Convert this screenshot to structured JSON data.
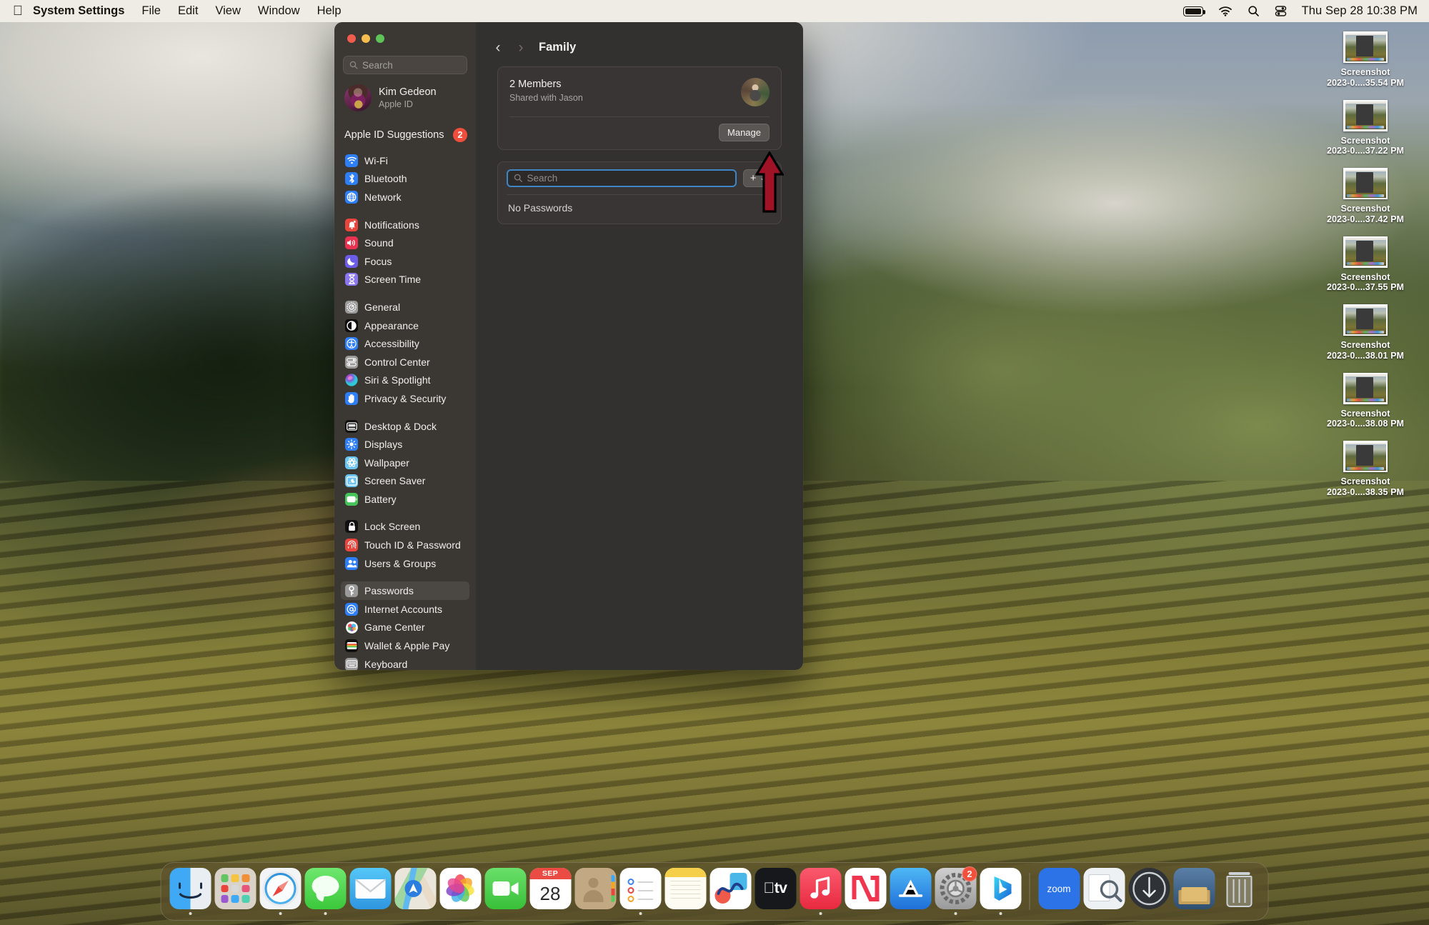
{
  "menubar": {
    "apple_icon": "apple-logo",
    "items": [
      "System Settings",
      "File",
      "Edit",
      "View",
      "Window",
      "Help"
    ],
    "status_icons": [
      "battery-icon",
      "wifi-icon",
      "search-icon",
      "control-center-icon"
    ],
    "clock": "Thu Sep 28  10:38 PM"
  },
  "desktop_icons": [
    {
      "line1": "Screenshot",
      "line2": "2023-0....35.54 PM"
    },
    {
      "line1": "Screenshot",
      "line2": "2023-0....37.22 PM"
    },
    {
      "line1": "Screenshot",
      "line2": "2023-0....37.42 PM"
    },
    {
      "line1": "Screenshot",
      "line2": "2023-0....37.55 PM"
    },
    {
      "line1": "Screenshot",
      "line2": "2023-0....38.01 PM"
    },
    {
      "line1": "Screenshot",
      "line2": "2023-0....38.08 PM"
    },
    {
      "line1": "Screenshot",
      "line2": "2023-0....38.35 PM"
    }
  ],
  "sidebar": {
    "search_placeholder": "Search",
    "account": {
      "name": "Kim Gedeon",
      "subtitle": "Apple ID"
    },
    "suggestions": {
      "label": "Apple ID Suggestions",
      "badge": "2"
    },
    "items": [
      {
        "label": "Wi-Fi",
        "icon": "wifi-icon",
        "color": "#2d7ef7",
        "selected": false,
        "gap_after": false
      },
      {
        "label": "Bluetooth",
        "icon": "bluetooth-icon",
        "color": "#2d7ef7",
        "selected": false,
        "gap_after": false
      },
      {
        "label": "Network",
        "icon": "globe-icon",
        "color": "#2d7ef7",
        "selected": false,
        "gap_after": true
      },
      {
        "label": "Notifications",
        "icon": "bell-icon",
        "color": "#e8453c",
        "selected": false,
        "gap_after": false
      },
      {
        "label": "Sound",
        "icon": "speaker-icon",
        "color": "#e8324f",
        "selected": false,
        "gap_after": false
      },
      {
        "label": "Focus",
        "icon": "moon-icon",
        "color": "#6c5ce7",
        "selected": false,
        "gap_after": false
      },
      {
        "label": "Screen Time",
        "icon": "hourglass-icon",
        "color": "#8a76f0",
        "selected": false,
        "gap_after": true
      },
      {
        "label": "General",
        "icon": "gear-icon",
        "color": "#9a9a9a",
        "selected": false,
        "gap_after": false
      },
      {
        "label": "Appearance",
        "icon": "contrast-icon",
        "color": "#0d0d0d",
        "selected": false,
        "gap_after": false
      },
      {
        "label": "Accessibility",
        "icon": "accessibility-icon",
        "color": "#2d7ef7",
        "selected": false,
        "gap_after": false
      },
      {
        "label": "Control Center",
        "icon": "control-center-icon",
        "color": "#9a9a9a",
        "selected": false,
        "gap_after": false
      },
      {
        "label": "Siri & Spotlight",
        "icon": "siri-icon",
        "color": "#6a4ac0",
        "selected": false,
        "gap_after": false
      },
      {
        "label": "Privacy & Security",
        "icon": "hand-icon",
        "color": "#2d7ef7",
        "selected": false,
        "gap_after": true
      },
      {
        "label": "Desktop & Dock",
        "icon": "desktop-dock-icon",
        "color": "#111111",
        "selected": false,
        "gap_after": false
      },
      {
        "label": "Displays",
        "icon": "brightness-icon",
        "color": "#2d7ef7",
        "selected": false,
        "gap_after": false
      },
      {
        "label": "Wallpaper",
        "icon": "wallpaper-icon",
        "color": "#6cc4f0",
        "selected": false,
        "gap_after": false
      },
      {
        "label": "Screen Saver",
        "icon": "screensaver-icon",
        "color": "#6cc4f0",
        "selected": false,
        "gap_after": false
      },
      {
        "label": "Battery",
        "icon": "battery-icon",
        "color": "#45c45a",
        "selected": false,
        "gap_after": true
      },
      {
        "label": "Lock Screen",
        "icon": "lock-icon",
        "color": "#111111",
        "selected": false,
        "gap_after": false
      },
      {
        "label": "Touch ID & Password",
        "icon": "touchid-icon",
        "color": "#e8453c",
        "selected": false,
        "gap_after": false
      },
      {
        "label": "Users & Groups",
        "icon": "users-icon",
        "color": "#2d7ef7",
        "selected": false,
        "gap_after": true
      },
      {
        "label": "Passwords",
        "icon": "key-icon",
        "color": "#9a9a9a",
        "selected": true,
        "gap_after": false
      },
      {
        "label": "Internet Accounts",
        "icon": "at-sign-icon",
        "color": "#2d7ef7",
        "selected": false,
        "gap_after": false
      },
      {
        "label": "Game Center",
        "icon": "game-center-icon",
        "color": "#ffffff",
        "selected": false,
        "gap_after": false
      },
      {
        "label": "Wallet & Apple Pay",
        "icon": "wallet-icon",
        "color": "#111111",
        "selected": false,
        "gap_after": false
      },
      {
        "label": "Keyboard",
        "icon": "keyboard-icon",
        "color": "#9a9a9a",
        "selected": false,
        "gap_after": false
      }
    ]
  },
  "main": {
    "back_icon": "chevron-left-icon",
    "forward_icon": "chevron-right-icon",
    "title": "Family",
    "family_card": {
      "members": "2 Members",
      "shared_with": "Shared with Jason",
      "manage_label": "Manage"
    },
    "passwords_card": {
      "search_placeholder": "Search",
      "add_label": "+",
      "add_chevron": "⌄",
      "empty_text": "No Passwords"
    }
  },
  "annotation": {
    "arrow": "red-up-arrow",
    "color": "#A01226"
  },
  "dock": {
    "items": [
      {
        "name": "finder",
        "running": true
      },
      {
        "name": "launchpad",
        "running": false
      },
      {
        "name": "safari",
        "running": true
      },
      {
        "name": "messages",
        "running": true
      },
      {
        "name": "mail",
        "running": false
      },
      {
        "name": "maps",
        "running": false
      },
      {
        "name": "photos",
        "running": false
      },
      {
        "name": "facetime",
        "running": false
      },
      {
        "name": "calendar",
        "running": false,
        "month": "SEP",
        "day": "28"
      },
      {
        "name": "contacts",
        "running": false
      },
      {
        "name": "reminders",
        "running": true
      },
      {
        "name": "notes",
        "running": false
      },
      {
        "name": "freeform",
        "running": false
      },
      {
        "name": "apple-tv",
        "running": false
      },
      {
        "name": "music",
        "running": true
      },
      {
        "name": "news",
        "running": false
      },
      {
        "name": "app-store",
        "running": false
      },
      {
        "name": "system-settings",
        "running": true,
        "badge": "2"
      },
      {
        "name": "bing",
        "running": true
      }
    ],
    "items_right": [
      {
        "name": "zoom",
        "label": "zoom",
        "running": false
      },
      {
        "name": "preview",
        "running": false
      },
      {
        "name": "downloads-stack",
        "running": false
      },
      {
        "name": "files-stack",
        "running": false
      },
      {
        "name": "trash",
        "running": false
      }
    ]
  }
}
